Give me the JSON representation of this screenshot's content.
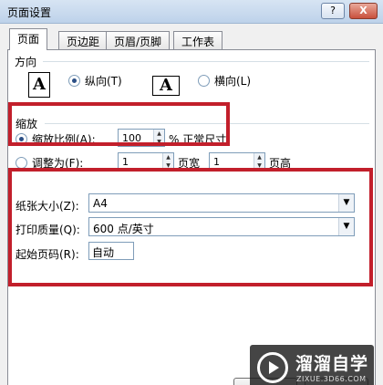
{
  "window": {
    "title": "页面设置",
    "help": "?",
    "close": "X"
  },
  "tabs": [
    {
      "label": "页面",
      "active": true
    },
    {
      "label": "页边距",
      "active": false
    },
    {
      "label": "页眉/页脚",
      "active": false
    },
    {
      "label": "工作表",
      "active": false
    }
  ],
  "orientation": {
    "section_label": "方向",
    "portrait_label": "纵向(T)",
    "landscape_label": "横向(L)",
    "icon_glyph": "A",
    "selected": "portrait"
  },
  "scaling": {
    "section_label": "缩放",
    "adjust_label": "缩放比例(A):",
    "adjust_value": "100",
    "adjust_suffix": "% 正常尺寸",
    "fit_label": "调整为(F):",
    "fit_wide_value": "1",
    "fit_wide_label": "页宽",
    "fit_tall_value": "1",
    "fit_tall_label": "页高",
    "selected": "adjust"
  },
  "paper": {
    "size_label": "纸张大小(Z):",
    "size_value": "A4",
    "quality_label": "打印质量(Q):",
    "quality_value": "600 点/英寸",
    "first_page_label": "起始页码(R):",
    "first_page_value": "自动"
  },
  "watermark": {
    "brand": "溜溜自学",
    "url": "ZIXUE.3D66.COM"
  },
  "colors": {
    "highlight": "#c21f2b"
  }
}
